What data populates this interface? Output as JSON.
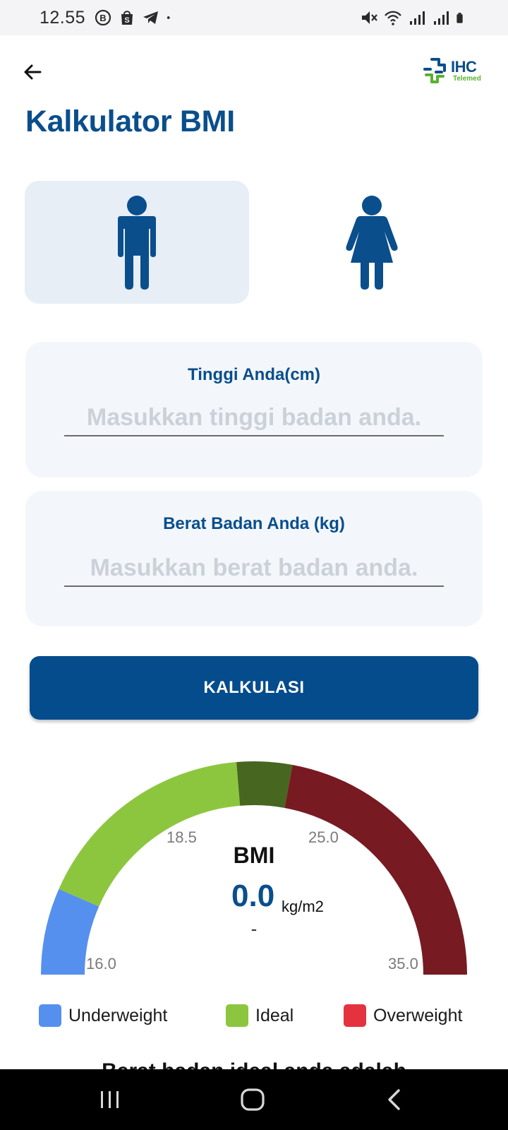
{
  "status_bar": {
    "time": "12.55",
    "left_icons": [
      "b-circle-icon",
      "shopping-bag-icon",
      "telegram-icon",
      "dot-icon"
    ],
    "right_icons": [
      "mute-icon",
      "wifi-icon",
      "signal-icon",
      "signal-icon",
      "battery-icon"
    ]
  },
  "header": {
    "logo_text": "IHC",
    "logo_subtext": "Telemed"
  },
  "page": {
    "title": "Kalkulator BMI"
  },
  "gender": {
    "options": [
      "male",
      "female"
    ],
    "selected": "male"
  },
  "height_field": {
    "label": "Tinggi Anda(cm)",
    "value": "",
    "placeholder": "Masukkan tinggi badan anda."
  },
  "weight_field": {
    "label": "Berat Badan Anda (kg)",
    "value": "",
    "placeholder": "Masukkan berat badan anda."
  },
  "calculate_button": {
    "label": "KALKULASI"
  },
  "chart_data": {
    "type": "gauge",
    "title": "BMI",
    "value": "0.0",
    "unit": "kg/m2",
    "status": "-",
    "range": [
      16.0,
      35.0
    ],
    "tick_labels": [
      "16.0",
      "18.5",
      "25.0",
      "35.0"
    ],
    "segments": [
      {
        "from": 16.0,
        "to": 18.5,
        "color": "#5590ee"
      },
      {
        "from": 18.5,
        "to": 25.0,
        "color": "#8cc63f"
      },
      {
        "from": 25.0,
        "to": 26.6,
        "color": "#476620"
      },
      {
        "from": 26.6,
        "to": 35.0,
        "color": "#771a21"
      }
    ]
  },
  "legend": [
    {
      "label": "Underweight",
      "color": "#5590ee"
    },
    {
      "label": "Ideal",
      "color": "#8cc63f"
    },
    {
      "label": "Overweight",
      "color": "#e5323f"
    }
  ],
  "partial_text": "Berat badan ideal anda adalah",
  "nav_bar": {
    "icons": [
      "recent-apps-icon",
      "home-icon",
      "back-icon"
    ]
  }
}
